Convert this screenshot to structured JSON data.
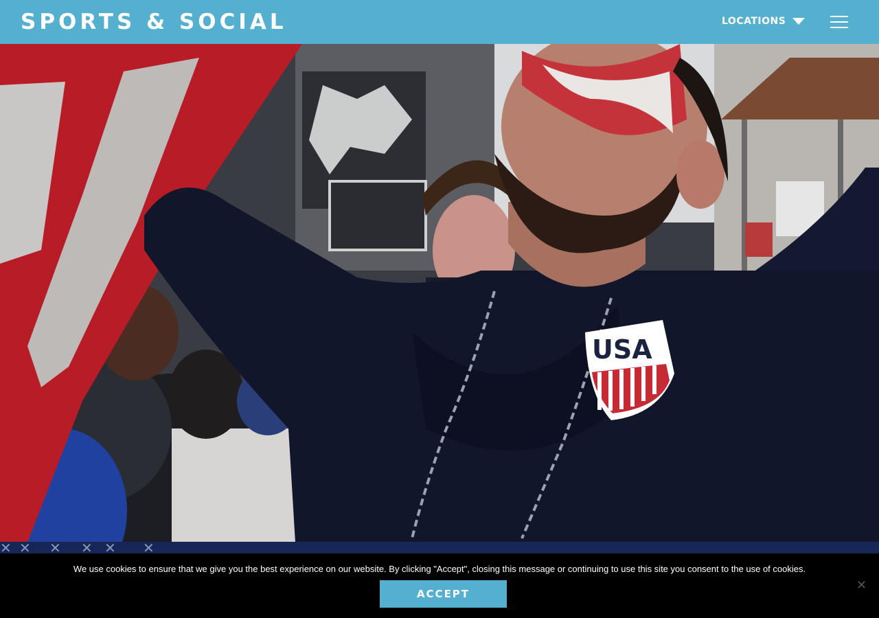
{
  "header": {
    "logo_text": "SPORTS & SOCIAL",
    "locations_label": "LOCATIONS",
    "background_color": "#55afcf",
    "menu_icon": "hamburger-menu-icon",
    "dropdown_icon": "caret-down-icon"
  },
  "hero": {
    "shirt_badge_text": "USA"
  },
  "cookie_banner": {
    "message": "We use cookies to ensure that we give you the best experience on our website. By clicking \"Accept\", closing this message or continuing to use this site you consent to the use of cookies.",
    "accept_label": "ACCEPT",
    "close_icon": "close-icon"
  }
}
